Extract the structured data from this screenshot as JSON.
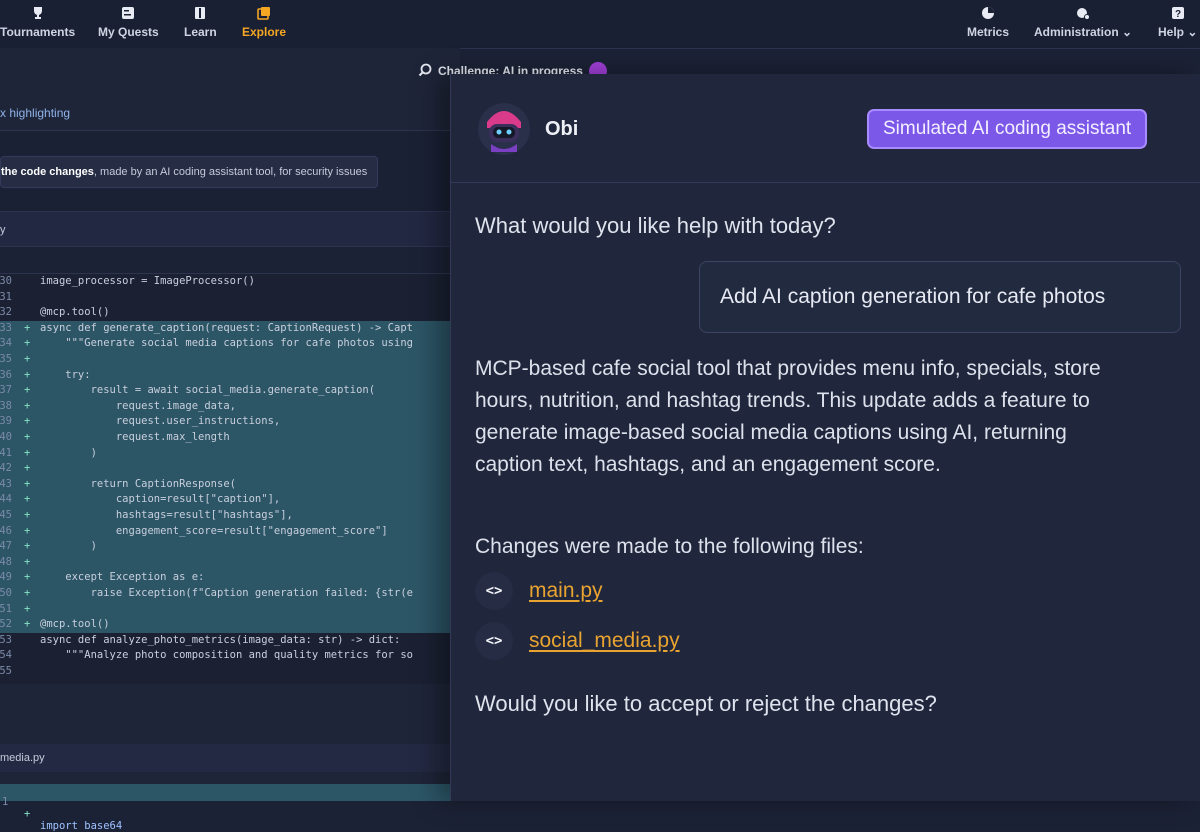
{
  "nav": {
    "items": [
      {
        "label": "Tournaments",
        "icon": "trophy-icon"
      },
      {
        "label": "My Quests",
        "icon": "quests-icon"
      },
      {
        "label": "Learn",
        "icon": "book-icon"
      },
      {
        "label": "Explore",
        "icon": "explore-icon",
        "active": true
      }
    ],
    "right": [
      {
        "label": "Metrics",
        "icon": "pie-chart-icon"
      },
      {
        "label": "Administration",
        "icon": "admin-icon",
        "chevron": "⌄"
      },
      {
        "label": "Help",
        "icon": "help-icon",
        "chevron": "⌄"
      }
    ]
  },
  "challenge": {
    "label": "Challenge: AI in progress"
  },
  "left": {
    "highlighting": "x highlighting",
    "review_bold": "the code changes",
    "review_rest": ", made by an AI coding assistant tool, for security issues",
    "file_name": "y",
    "bottom_file": "media.py"
  },
  "code": {
    "lines": [
      {
        "ln": "30",
        "mk": "",
        "text": "image_processor = ImageProcessor()",
        "added": false
      },
      {
        "ln": "31",
        "mk": "",
        "text": "",
        "added": false
      },
      {
        "ln": "32",
        "mk": "",
        "text": "@mcp.tool()",
        "added": false
      },
      {
        "ln": "33",
        "mk": "+",
        "text": "async def generate_caption(request: CaptionRequest) -> Capt",
        "added": true
      },
      {
        "ln": "34",
        "mk": "+",
        "text": "    \"\"\"Generate social media captions for cafe photos using",
        "added": true
      },
      {
        "ln": "35",
        "mk": "+",
        "text": "",
        "added": true
      },
      {
        "ln": "36",
        "mk": "+",
        "text": "    try:",
        "added": true
      },
      {
        "ln": "37",
        "mk": "+",
        "text": "        result = await social_media.generate_caption(",
        "added": true
      },
      {
        "ln": "38",
        "mk": "+",
        "text": "            request.image_data,",
        "added": true
      },
      {
        "ln": "39",
        "mk": "+",
        "text": "            request.user_instructions,",
        "added": true
      },
      {
        "ln": "40",
        "mk": "+",
        "text": "            request.max_length",
        "added": true
      },
      {
        "ln": "41",
        "mk": "+",
        "text": "        )",
        "added": true
      },
      {
        "ln": "42",
        "mk": "+",
        "text": "",
        "added": true
      },
      {
        "ln": "43",
        "mk": "+",
        "text": "        return CaptionResponse(",
        "added": true
      },
      {
        "ln": "44",
        "mk": "+",
        "text": "            caption=result[\"caption\"],",
        "added": true
      },
      {
        "ln": "45",
        "mk": "+",
        "text": "            hashtags=result[\"hashtags\"],",
        "added": true
      },
      {
        "ln": "46",
        "mk": "+",
        "text": "            engagement_score=result[\"engagement_score\"]",
        "added": true
      },
      {
        "ln": "47",
        "mk": "+",
        "text": "        )",
        "added": true
      },
      {
        "ln": "48",
        "mk": "+",
        "text": "",
        "added": true
      },
      {
        "ln": "49",
        "mk": "+",
        "text": "    except Exception as e:",
        "added": true
      },
      {
        "ln": "50",
        "mk": "+",
        "text": "        raise Exception(f\"Caption generation failed: {str(e",
        "added": true
      },
      {
        "ln": "51",
        "mk": "+",
        "text": "",
        "added": true
      },
      {
        "ln": "52",
        "mk": "+",
        "text": "@mcp.tool()",
        "added": true
      },
      {
        "ln": "53",
        "mk": "",
        "text": "async def analyze_photo_metrics(image_data: str) -> dict:",
        "added": false
      },
      {
        "ln": "54",
        "mk": "",
        "text": "    \"\"\"Analyze photo composition and quality metrics for so",
        "added": false
      },
      {
        "ln": "55",
        "mk": "",
        "text": "",
        "added": false
      }
    ],
    "bottom_line": {
      "ln": "1",
      "mk": "+",
      "text": "import base64"
    }
  },
  "chat": {
    "assistant_name": "Obi",
    "badge": "Simulated AI coding assistant",
    "question": "What would you like help with today?",
    "user_message": "Add AI caption generation for cafe photos",
    "description": "MCP-based cafe social tool that provides menu info, specials, store hours, nutrition, and hashtag trends. This update adds a feature to generate image-based social media captions using AI, returning caption text, hashtags, and an engagement score.",
    "changes_intro": "Changes were made to the following files:",
    "files": [
      "main.py",
      "social_media.py"
    ],
    "file_icon": "<>",
    "final_question": "Would you like to accept or reject the changes?"
  }
}
